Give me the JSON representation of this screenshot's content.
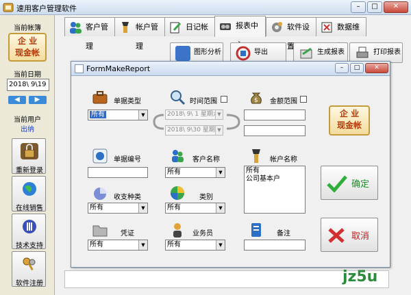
{
  "window": {
    "title": "速用客户管理软件"
  },
  "sidebar": {
    "current_book_label": "当前帐簿",
    "logo_line1": "企 业",
    "logo_line2": "现金帐",
    "current_date_label": "当前日期",
    "current_date_value": "2018\\ 9\\19",
    "current_user_label": "当前用户",
    "current_user_value": "出纳",
    "buttons": [
      {
        "label": "重新登录",
        "icon": "lock-icon"
      },
      {
        "label": "在线销售",
        "icon": "globe-icon"
      },
      {
        "label": "技术支持",
        "icon": "support-icon"
      },
      {
        "label": "软件注册",
        "icon": "keys-icon"
      }
    ]
  },
  "tabs": [
    {
      "label": "客户管理",
      "icon": "users-icon"
    },
    {
      "label": "帐户管理",
      "icon": "account-icon"
    },
    {
      "label": "日记帐簿",
      "icon": "journal-icon"
    },
    {
      "label": "报表中心",
      "icon": "report-icon",
      "active": true
    },
    {
      "label": "软件设置",
      "icon": "gear-icon"
    },
    {
      "label": "数据维护",
      "icon": "data-icon"
    }
  ],
  "toolbar": {
    "analysis": "图形分析",
    "export": "导出EXCEL",
    "generate": "生成报表",
    "print": "打印报表"
  },
  "dialog": {
    "title": "FormMakeReport",
    "doc_type_label": "单据类型",
    "doc_type_value": "所有",
    "time_range_label": "时间范围",
    "date_from": "2018\\ 9\\ 1 星期六",
    "date_to": "2018\\ 9\\30 星期日",
    "amount_range_label": "金额范围",
    "logo_line1": "企 业",
    "logo_line2": "现金帐",
    "doc_no_label": "单据编号",
    "customer_label": "客户名称",
    "customer_value": "所有",
    "account_label": "帐户名称",
    "account_items": [
      "所有",
      "公司基本户"
    ],
    "income_type_label": "收支种类",
    "income_type_value": "所有",
    "category_label": "类别",
    "category_value": "所有",
    "voucher_label": "凭证",
    "voucher_value": "所有",
    "salesman_label": "业务员",
    "salesman_value": "所有",
    "remark_label": "备注",
    "ok_label": "确定",
    "cancel_label": "取消"
  },
  "watermark": "jz5u"
}
